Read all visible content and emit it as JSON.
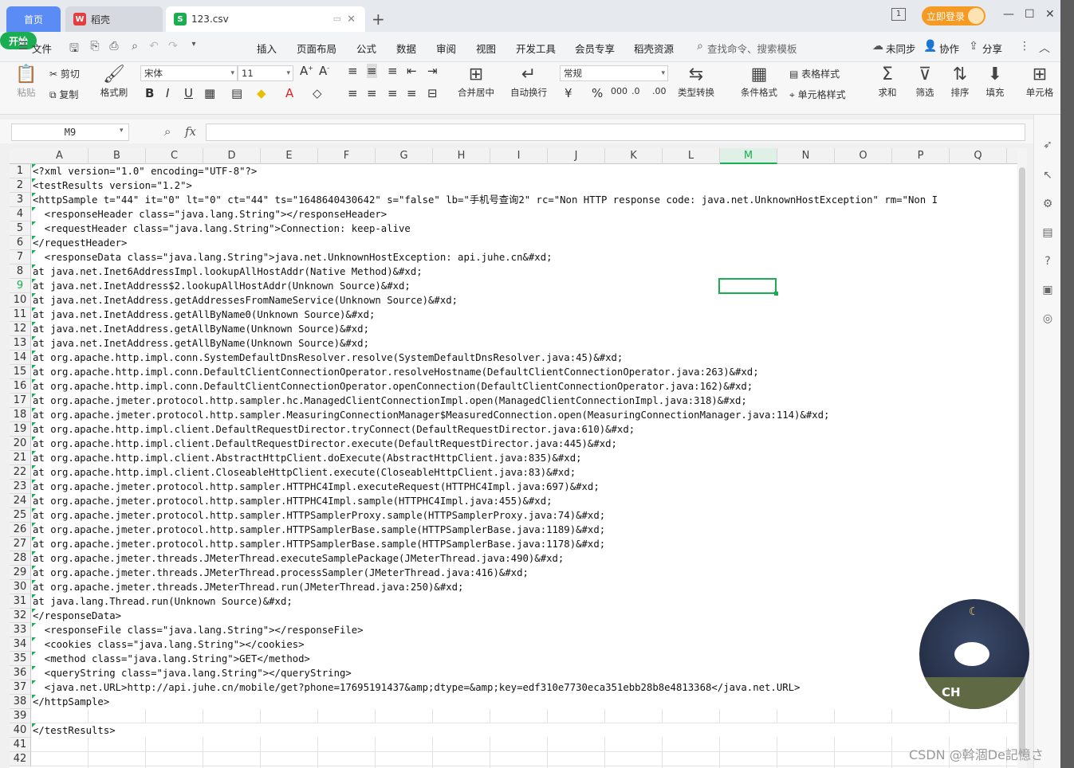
{
  "titlebar": {
    "tab_home": "首页",
    "tab_docer": "稻壳",
    "tab_file": "123.csv",
    "login": "立即登录",
    "page_indicator": "1"
  },
  "menu": {
    "file": "文件",
    "items": [
      "开始",
      "插入",
      "页面布局",
      "公式",
      "数据",
      "审阅",
      "视图",
      "开发工具",
      "会员专享",
      "稻壳资源"
    ],
    "search": "查找命令、搜索模板",
    "unsync": "未同步",
    "collab": "协作",
    "share": "分享"
  },
  "ribbon": {
    "paste": "粘贴",
    "cut": "剪切",
    "copy": "复制",
    "format_painter": "格式刷",
    "font_name": "宋体",
    "font_size": "11",
    "merge_center": "合并居中",
    "auto_wrap": "自动换行",
    "number_format": "常规",
    "type_convert": "类型转换",
    "cond_format": "条件格式",
    "table_style": "表格样式",
    "cell_style": "单元格样式",
    "sum": "求和",
    "filter": "筛选",
    "sort": "排序",
    "fill": "填充",
    "cell": "单元格"
  },
  "formula_bar": {
    "name_box": "M9",
    "fx": "fx",
    "value": ""
  },
  "sheet": {
    "columns": [
      "A",
      "B",
      "C",
      "D",
      "E",
      "F",
      "G",
      "H",
      "I",
      "J",
      "K",
      "L",
      "M",
      "N",
      "O",
      "P",
      "Q"
    ],
    "selected_column": "M",
    "selected_row": 9,
    "rows": [
      "<?xml version=\"1.0\" encoding=\"UTF-8\"?>",
      "<testResults version=\"1.2\">",
      "<httpSample t=\"44\" it=\"0\" lt=\"0\" ct=\"44\" ts=\"1648640430642\" s=\"false\" lb=\"手机号查询2\" rc=\"Non HTTP response code: java.net.UnknownHostException\" rm=\"Non I",
      "  <responseHeader class=\"java.lang.String\"></responseHeader>",
      "  <requestHeader class=\"java.lang.String\">Connection: keep-alive",
      "</requestHeader>",
      "  <responseData class=\"java.lang.String\">java.net.UnknownHostException: api.juhe.cn&#xd;",
      "at java.net.Inet6AddressImpl.lookupAllHostAddr(Native Method)&#xd;",
      "at java.net.InetAddress$2.lookupAllHostAddr(Unknown Source)&#xd;",
      "at java.net.InetAddress.getAddressesFromNameService(Unknown Source)&#xd;",
      "at java.net.InetAddress.getAllByName0(Unknown Source)&#xd;",
      "at java.net.InetAddress.getAllByName(Unknown Source)&#xd;",
      "at java.net.InetAddress.getAllByName(Unknown Source)&#xd;",
      "at org.apache.http.impl.conn.SystemDefaultDnsResolver.resolve(SystemDefaultDnsResolver.java:45)&#xd;",
      "at org.apache.http.impl.conn.DefaultClientConnectionOperator.resolveHostname(DefaultClientConnectionOperator.java:263)&#xd;",
      "at org.apache.http.impl.conn.DefaultClientConnectionOperator.openConnection(DefaultClientConnectionOperator.java:162)&#xd;",
      "at org.apache.jmeter.protocol.http.sampler.hc.ManagedClientConnectionImpl.open(ManagedClientConnectionImpl.java:318)&#xd;",
      "at org.apache.jmeter.protocol.http.sampler.MeasuringConnectionManager$MeasuredConnection.open(MeasuringConnectionManager.java:114)&#xd;",
      "at org.apache.http.impl.client.DefaultRequestDirector.tryConnect(DefaultRequestDirector.java:610)&#xd;",
      "at org.apache.http.impl.client.DefaultRequestDirector.execute(DefaultRequestDirector.java:445)&#xd;",
      "at org.apache.http.impl.client.AbstractHttpClient.doExecute(AbstractHttpClient.java:835)&#xd;",
      "at org.apache.http.impl.client.CloseableHttpClient.execute(CloseableHttpClient.java:83)&#xd;",
      "at org.apache.jmeter.protocol.http.sampler.HTTPHC4Impl.executeRequest(HTTPHC4Impl.java:697)&#xd;",
      "at org.apache.jmeter.protocol.http.sampler.HTTPHC4Impl.sample(HTTPHC4Impl.java:455)&#xd;",
      "at org.apache.jmeter.protocol.http.sampler.HTTPSamplerProxy.sample(HTTPSamplerProxy.java:74)&#xd;",
      "at org.apache.jmeter.protocol.http.sampler.HTTPSamplerBase.sample(HTTPSamplerBase.java:1189)&#xd;",
      "at org.apache.jmeter.protocol.http.sampler.HTTPSamplerBase.sample(HTTPSamplerBase.java:1178)&#xd;",
      "at org.apache.jmeter.threads.JMeterThread.executeSamplePackage(JMeterThread.java:490)&#xd;",
      "at org.apache.jmeter.threads.JMeterThread.processSampler(JMeterThread.java:416)&#xd;",
      "at org.apache.jmeter.threads.JMeterThread.run(JMeterThread.java:250)&#xd;",
      "at java.lang.Thread.run(Unknown Source)&#xd;",
      "</responseData>",
      "  <responseFile class=\"java.lang.String\"></responseFile>",
      "  <cookies class=\"java.lang.String\"></cookies>",
      "  <method class=\"java.lang.String\">GET</method>",
      "  <queryString class=\"java.lang.String\"></queryString>",
      "  <java.net.URL>http://api.juhe.cn/mobile/get?phone=17695191437&amp;dtype=&amp;key=edf310e7730eca351ebb28b8e4813368</java.net.URL>",
      "</httpSample>",
      "",
      "</testResults>",
      "",
      ""
    ]
  },
  "widget": {
    "label": "CH"
  },
  "watermark": "CSDN @斡涸De記憶さ",
  "colors": {
    "accent": "#1aad52",
    "home_tab": "#5b8cf5",
    "login": "#f59a23"
  }
}
